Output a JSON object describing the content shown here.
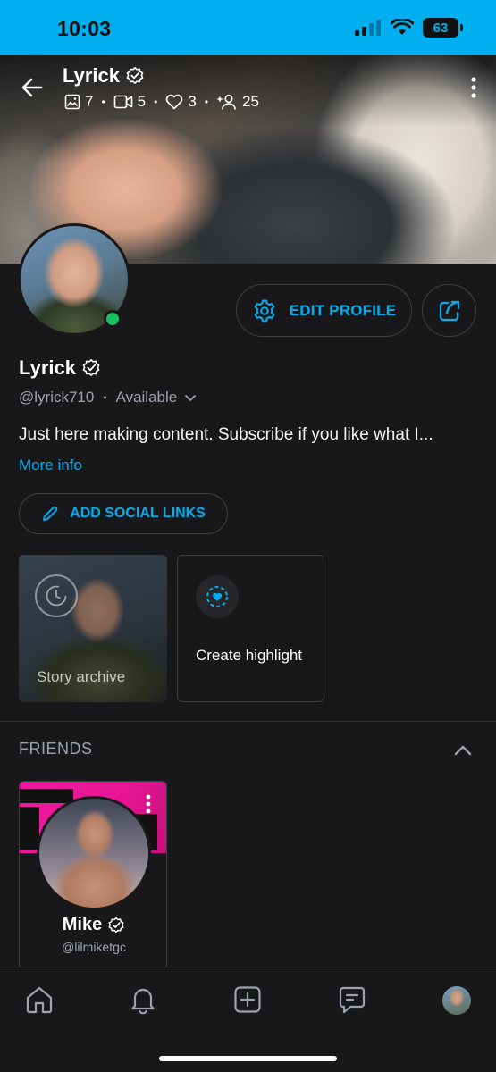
{
  "status_bar": {
    "time": "10:03",
    "battery": "63"
  },
  "header": {
    "name": "Lyrick",
    "stats": [
      {
        "icon": "image-icon",
        "count": "7"
      },
      {
        "icon": "video-icon",
        "count": "5"
      },
      {
        "icon": "heart-icon",
        "count": "3"
      },
      {
        "icon": "fans-icon",
        "count": "25"
      }
    ]
  },
  "profile": {
    "edit_label": "EDIT PROFILE",
    "name": "Lyrick",
    "handle": "@lyrick710",
    "availability": "Available",
    "bio": "Just here making content. Subscribe if you like what I...",
    "more_info": "More info",
    "social_links_label": "ADD SOCIAL LINKS"
  },
  "highlights": {
    "story_archive_label": "Story archive",
    "create_label": "Create highlight"
  },
  "friends": {
    "title": "FRIENDS",
    "items": [
      {
        "name": "Mike",
        "handle": "@lilmiketgc"
      }
    ]
  },
  "colors": {
    "accent": "#00aff0",
    "background": "#18181b",
    "online": "#19c25c",
    "border": "#3f3f46"
  }
}
